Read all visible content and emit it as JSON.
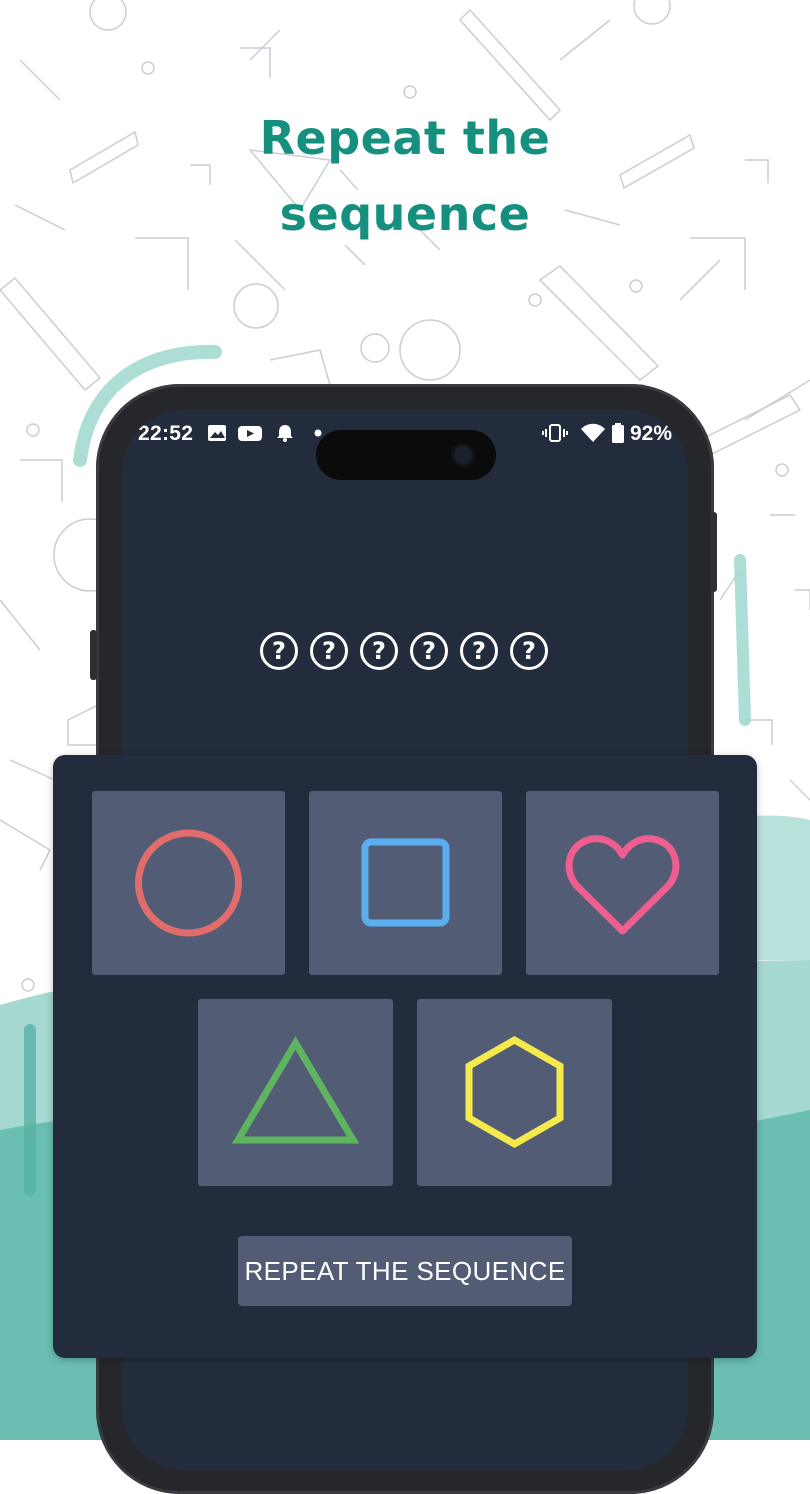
{
  "headline": {
    "line1": "Repeat the",
    "line2": "sequence"
  },
  "colors": {
    "accent": "#16907e",
    "teal_blob": "#6bbfb2",
    "screen_bg": "#232c3d",
    "tile_bg": "#525d75",
    "circle": "#e06c6c",
    "square": "#5aaef0",
    "heart": "#ee5e8e",
    "triangle": "#5fb55f",
    "hexagon": "#f5e94b"
  },
  "status_bar": {
    "time": "22:52",
    "battery": "92%",
    "icons": [
      "image-icon",
      "youtube-icon",
      "bell-icon",
      "dot-icon",
      "vibrate-icon",
      "wifi-icon",
      "battery-icon"
    ]
  },
  "sequence": {
    "slots": [
      "?",
      "?",
      "?",
      "?",
      "?",
      "?"
    ]
  },
  "shapes": [
    "circle",
    "square",
    "heart",
    "triangle",
    "hexagon"
  ],
  "repeat_button": {
    "label": "REPEAT THE SEQUENCE"
  }
}
